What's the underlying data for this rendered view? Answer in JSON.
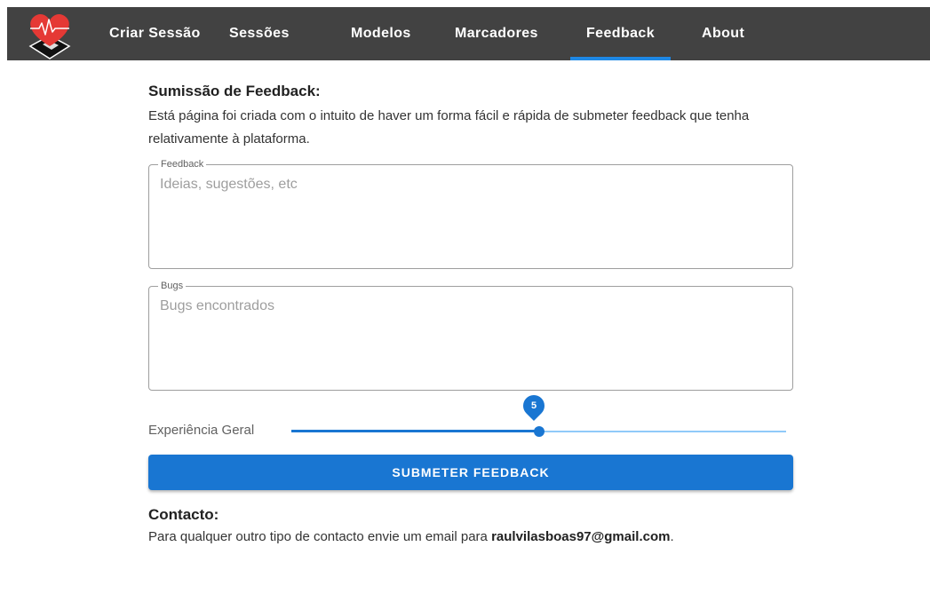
{
  "nav": {
    "items": [
      {
        "label": "Criar Sessão",
        "active": false
      },
      {
        "label": "Sessões",
        "active": false
      },
      {
        "label": "Modelos",
        "active": false
      },
      {
        "label": "Marcadores",
        "active": false
      },
      {
        "label": "Feedback",
        "active": true
      },
      {
        "label": "About",
        "active": false
      }
    ],
    "logo_icon": "heart-monitor-logo-icon"
  },
  "feedback_section": {
    "title": "Sumissão de Feedback:",
    "description": "Está página foi criada com o intuito de haver um forma fácil e rápida de submeter feedback que tenha relativamente à plataforma.",
    "feedback_field": {
      "label": "Feedback",
      "placeholder": "Ideias, sugestões, etc",
      "value": ""
    },
    "bugs_field": {
      "label": "Bugs",
      "placeholder": "Bugs encontrados",
      "value": ""
    },
    "experience": {
      "label": "Experiência Geral",
      "value": "5",
      "min": 0,
      "max": 10,
      "fraction": 0.5
    },
    "submit_label": "SUBMETER FEEDBACK"
  },
  "contact": {
    "title": "Contacto:",
    "text": "Para qualquer outro tipo de contacto envie um email para ",
    "email": "raulvilasboas97@gmail.com",
    "suffix": "."
  },
  "colors": {
    "navbar": "#424242",
    "accent": "#1976d2",
    "active_tab_indicator": "#1e88e5",
    "logo_heart": "#e53935"
  }
}
